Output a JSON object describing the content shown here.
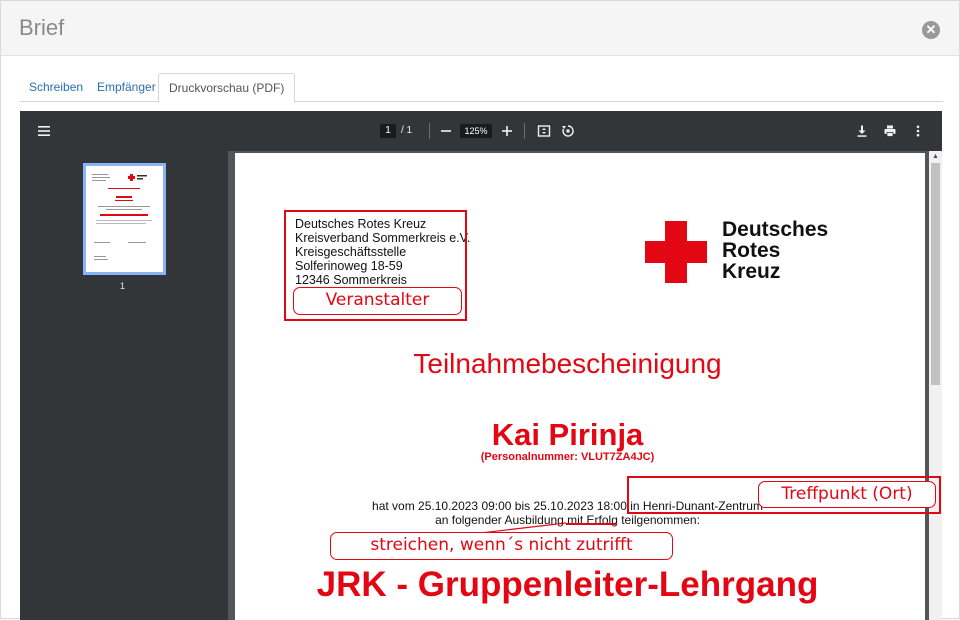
{
  "dialog": {
    "title": "Brief"
  },
  "tabs": [
    {
      "label": "Schreiben"
    },
    {
      "label": "Empfänger"
    },
    {
      "label": "Druckvorschau (PDF)"
    }
  ],
  "viewer": {
    "current_page": "1",
    "total_pages": "/  1",
    "zoom": "125%",
    "thumbnail_label": "1"
  },
  "document": {
    "sender": [
      "Deutsches Rotes Kreuz",
      "Kreisverband Sommerkreis e.V.",
      "Kreisgeschäftsstelle",
      "Solferinoweg 18-59",
      "12346 Sommerkreis"
    ],
    "logo_text": [
      "Deutsches",
      "Rotes",
      "Kreuz"
    ],
    "title": "Teilnahmebescheinigung",
    "name": "Kai Pirinja",
    "personal_number": "(Personalnummer: VLUT7ZA4JC)",
    "line1": "hat vom 25.10.2023 09:00 bis 25.10.2023 18:00 in Henri-Dunant-Zentrum",
    "line2": "an folgender Ausbildung mit Erfolg teilgenommen:",
    "course": "JRK - Gruppenleiter-Lehrgang"
  },
  "annotations": {
    "organizer": "Veranstalter",
    "meeting_point": "Treffpunkt (Ort)",
    "strike_note": "streichen, wenn´s nicht zutrifft"
  },
  "colors": {
    "accent_red": "#e30613",
    "link_blue": "#2a6fb3",
    "viewer_bg": "#525659",
    "toolbar_bg": "#323639"
  },
  "icons": [
    "close-icon",
    "menu-icon",
    "zoom-out-icon",
    "zoom-in-icon",
    "fit-page-icon",
    "rotate-icon",
    "download-icon",
    "print-icon",
    "more-vert-icon"
  ]
}
